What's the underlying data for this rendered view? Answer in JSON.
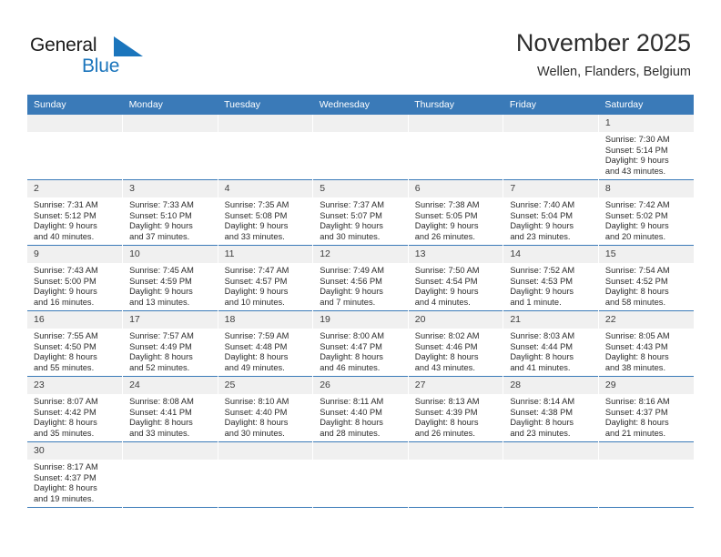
{
  "brand": {
    "name_part1": "General",
    "name_part2": "Blue",
    "color_black": "#1a1a1a",
    "color_blue": "#1b75bc",
    "flag_icon": "blue-triangle-flag-icon"
  },
  "header": {
    "title": "November 2025",
    "subtitle": "Wellen, Flanders, Belgium"
  },
  "theme": {
    "header_blue": "#3a7ab8",
    "daynum_gray": "#f0f0f0",
    "text": "#2b2b2b"
  },
  "calendar": {
    "weekday_headers": [
      "Sunday",
      "Monday",
      "Tuesday",
      "Wednesday",
      "Thursday",
      "Friday",
      "Saturday"
    ],
    "weeks": [
      [
        {
          "day": "",
          "lines": []
        },
        {
          "day": "",
          "lines": []
        },
        {
          "day": "",
          "lines": []
        },
        {
          "day": "",
          "lines": []
        },
        {
          "day": "",
          "lines": []
        },
        {
          "day": "",
          "lines": []
        },
        {
          "day": "1",
          "lines": [
            "Sunrise: 7:30 AM",
            "Sunset: 5:14 PM",
            "Daylight: 9 hours",
            "and 43 minutes."
          ]
        }
      ],
      [
        {
          "day": "2",
          "lines": [
            "Sunrise: 7:31 AM",
            "Sunset: 5:12 PM",
            "Daylight: 9 hours",
            "and 40 minutes."
          ]
        },
        {
          "day": "3",
          "lines": [
            "Sunrise: 7:33 AM",
            "Sunset: 5:10 PM",
            "Daylight: 9 hours",
            "and 37 minutes."
          ]
        },
        {
          "day": "4",
          "lines": [
            "Sunrise: 7:35 AM",
            "Sunset: 5:08 PM",
            "Daylight: 9 hours",
            "and 33 minutes."
          ]
        },
        {
          "day": "5",
          "lines": [
            "Sunrise: 7:37 AM",
            "Sunset: 5:07 PM",
            "Daylight: 9 hours",
            "and 30 minutes."
          ]
        },
        {
          "day": "6",
          "lines": [
            "Sunrise: 7:38 AM",
            "Sunset: 5:05 PM",
            "Daylight: 9 hours",
            "and 26 minutes."
          ]
        },
        {
          "day": "7",
          "lines": [
            "Sunrise: 7:40 AM",
            "Sunset: 5:04 PM",
            "Daylight: 9 hours",
            "and 23 minutes."
          ]
        },
        {
          "day": "8",
          "lines": [
            "Sunrise: 7:42 AM",
            "Sunset: 5:02 PM",
            "Daylight: 9 hours",
            "and 20 minutes."
          ]
        }
      ],
      [
        {
          "day": "9",
          "lines": [
            "Sunrise: 7:43 AM",
            "Sunset: 5:00 PM",
            "Daylight: 9 hours",
            "and 16 minutes."
          ]
        },
        {
          "day": "10",
          "lines": [
            "Sunrise: 7:45 AM",
            "Sunset: 4:59 PM",
            "Daylight: 9 hours",
            "and 13 minutes."
          ]
        },
        {
          "day": "11",
          "lines": [
            "Sunrise: 7:47 AM",
            "Sunset: 4:57 PM",
            "Daylight: 9 hours",
            "and 10 minutes."
          ]
        },
        {
          "day": "12",
          "lines": [
            "Sunrise: 7:49 AM",
            "Sunset: 4:56 PM",
            "Daylight: 9 hours",
            "and 7 minutes."
          ]
        },
        {
          "day": "13",
          "lines": [
            "Sunrise: 7:50 AM",
            "Sunset: 4:54 PM",
            "Daylight: 9 hours",
            "and 4 minutes."
          ]
        },
        {
          "day": "14",
          "lines": [
            "Sunrise: 7:52 AM",
            "Sunset: 4:53 PM",
            "Daylight: 9 hours",
            "and 1 minute."
          ]
        },
        {
          "day": "15",
          "lines": [
            "Sunrise: 7:54 AM",
            "Sunset: 4:52 PM",
            "Daylight: 8 hours",
            "and 58 minutes."
          ]
        }
      ],
      [
        {
          "day": "16",
          "lines": [
            "Sunrise: 7:55 AM",
            "Sunset: 4:50 PM",
            "Daylight: 8 hours",
            "and 55 minutes."
          ]
        },
        {
          "day": "17",
          "lines": [
            "Sunrise: 7:57 AM",
            "Sunset: 4:49 PM",
            "Daylight: 8 hours",
            "and 52 minutes."
          ]
        },
        {
          "day": "18",
          "lines": [
            "Sunrise: 7:59 AM",
            "Sunset: 4:48 PM",
            "Daylight: 8 hours",
            "and 49 minutes."
          ]
        },
        {
          "day": "19",
          "lines": [
            "Sunrise: 8:00 AM",
            "Sunset: 4:47 PM",
            "Daylight: 8 hours",
            "and 46 minutes."
          ]
        },
        {
          "day": "20",
          "lines": [
            "Sunrise: 8:02 AM",
            "Sunset: 4:46 PM",
            "Daylight: 8 hours",
            "and 43 minutes."
          ]
        },
        {
          "day": "21",
          "lines": [
            "Sunrise: 8:03 AM",
            "Sunset: 4:44 PM",
            "Daylight: 8 hours",
            "and 41 minutes."
          ]
        },
        {
          "day": "22",
          "lines": [
            "Sunrise: 8:05 AM",
            "Sunset: 4:43 PM",
            "Daylight: 8 hours",
            "and 38 minutes."
          ]
        }
      ],
      [
        {
          "day": "23",
          "lines": [
            "Sunrise: 8:07 AM",
            "Sunset: 4:42 PM",
            "Daylight: 8 hours",
            "and 35 minutes."
          ]
        },
        {
          "day": "24",
          "lines": [
            "Sunrise: 8:08 AM",
            "Sunset: 4:41 PM",
            "Daylight: 8 hours",
            "and 33 minutes."
          ]
        },
        {
          "day": "25",
          "lines": [
            "Sunrise: 8:10 AM",
            "Sunset: 4:40 PM",
            "Daylight: 8 hours",
            "and 30 minutes."
          ]
        },
        {
          "day": "26",
          "lines": [
            "Sunrise: 8:11 AM",
            "Sunset: 4:40 PM",
            "Daylight: 8 hours",
            "and 28 minutes."
          ]
        },
        {
          "day": "27",
          "lines": [
            "Sunrise: 8:13 AM",
            "Sunset: 4:39 PM",
            "Daylight: 8 hours",
            "and 26 minutes."
          ]
        },
        {
          "day": "28",
          "lines": [
            "Sunrise: 8:14 AM",
            "Sunset: 4:38 PM",
            "Daylight: 8 hours",
            "and 23 minutes."
          ]
        },
        {
          "day": "29",
          "lines": [
            "Sunrise: 8:16 AM",
            "Sunset: 4:37 PM",
            "Daylight: 8 hours",
            "and 21 minutes."
          ]
        }
      ],
      [
        {
          "day": "30",
          "lines": [
            "Sunrise: 8:17 AM",
            "Sunset: 4:37 PM",
            "Daylight: 8 hours",
            "and 19 minutes."
          ]
        },
        {
          "day": "",
          "lines": []
        },
        {
          "day": "",
          "lines": []
        },
        {
          "day": "",
          "lines": []
        },
        {
          "day": "",
          "lines": []
        },
        {
          "day": "",
          "lines": []
        },
        {
          "day": "",
          "lines": []
        }
      ]
    ]
  }
}
